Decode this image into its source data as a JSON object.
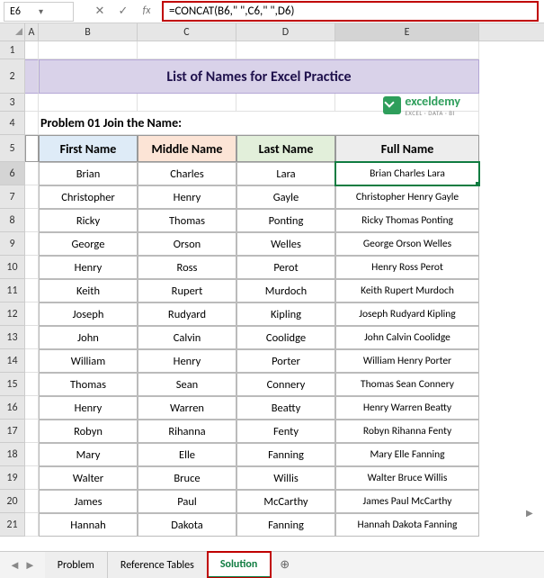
{
  "name_box": "E6",
  "formula": "=CONCAT(B6,\" \",C6,\" \",D6)",
  "columns": [
    "A",
    "B",
    "C",
    "D",
    "E"
  ],
  "title": "List of Names for Excel Practice",
  "problem_label": "Problem 01 Join the Name:",
  "logo": {
    "text": "exceldemy",
    "sub": "EXCEL · DATA · BI"
  },
  "headers": {
    "b": "First Name",
    "c": "Middle Name",
    "d": "Last Name",
    "e": "Full Name"
  },
  "chart_data": {
    "type": "table",
    "columns": [
      "First Name",
      "Middle Name",
      "Last Name",
      "Full Name"
    ],
    "rows": [
      [
        "Brian",
        "Charles",
        "Lara",
        "Brian Charles Lara"
      ],
      [
        "Christopher",
        "Henry",
        "Gayle",
        "Christopher Henry Gayle"
      ],
      [
        "Ricky",
        "Thomas",
        "Ponting",
        "Ricky Thomas Ponting"
      ],
      [
        "George",
        "Orson",
        "Welles",
        "George Orson Welles"
      ],
      [
        "Henry",
        "Ross",
        "Perot",
        "Henry Ross Perot"
      ],
      [
        "Keith",
        "Rupert",
        "Murdoch",
        "Keith Rupert Murdoch"
      ],
      [
        "Joseph",
        "Rudyard",
        "Kipling",
        "Joseph Rudyard Kipling"
      ],
      [
        "John",
        "Calvin",
        "Coolidge",
        "John Calvin Coolidge"
      ],
      [
        "William",
        "Henry",
        "Porter",
        "William Henry Porter"
      ],
      [
        "Thomas",
        "Sean",
        "Connery",
        "Thomas Sean Connery"
      ],
      [
        "Henry",
        "Warren",
        "Beatty",
        "Henry Warren Beatty"
      ],
      [
        "Robyn",
        "Rihanna",
        "Fenty",
        "Robyn Rihanna Fenty"
      ],
      [
        "Mary",
        "Elle",
        "Fanning",
        "Mary Elle Fanning"
      ],
      [
        "Walter",
        "Bruce",
        "Willis",
        "Walter Bruce Willis"
      ],
      [
        "James",
        "Paul",
        "McCarthy",
        "James Paul McCarthy"
      ],
      [
        "Hannah",
        "Dakota",
        "Fanning",
        "Hannah Dakota Fanning"
      ]
    ]
  },
  "row_heights": {
    "r1": 20,
    "r2": 38,
    "r3": 20,
    "r4": 26,
    "r5": 30,
    "data": 26
  },
  "tabs": [
    "Problem",
    "Reference Tables",
    "Solution"
  ],
  "active_tab": 2
}
